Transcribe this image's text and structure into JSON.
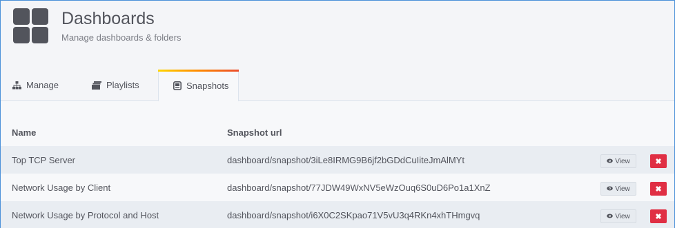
{
  "page": {
    "title": "Dashboards",
    "subtitle": "Manage dashboards & folders"
  },
  "tabs": [
    {
      "label": "Manage",
      "icon": "sitemap-icon",
      "active": false
    },
    {
      "label": "Playlists",
      "icon": "playlist-icon",
      "active": false
    },
    {
      "label": "Snapshots",
      "icon": "snapshot-icon",
      "active": true
    }
  ],
  "table": {
    "columns": [
      "Name",
      "Snapshot url"
    ],
    "rows": [
      {
        "name": "Top TCP Server",
        "url": "dashboard/snapshot/3iLe8IRMG9B6jf2bGDdCuIiteJmAlMYt",
        "view_label": "View"
      },
      {
        "name": "Network Usage by Client",
        "url": "dashboard/snapshot/77JDW49WxNV5eWzOuq6S0uD6Po1a1XnZ",
        "view_label": "View"
      },
      {
        "name": "Network Usage by Protocol and Host",
        "url": "dashboard/snapshot/i6X0C2SKpao71V5vU3q4RKn4xhTHmgvq",
        "view_label": "View"
      }
    ]
  },
  "colors": {
    "accent_gradient": [
      "#ffd500",
      "#ff8a00",
      "#eb4d2c"
    ],
    "delete": "#e02f44",
    "frame_border": "#4a90d9"
  }
}
